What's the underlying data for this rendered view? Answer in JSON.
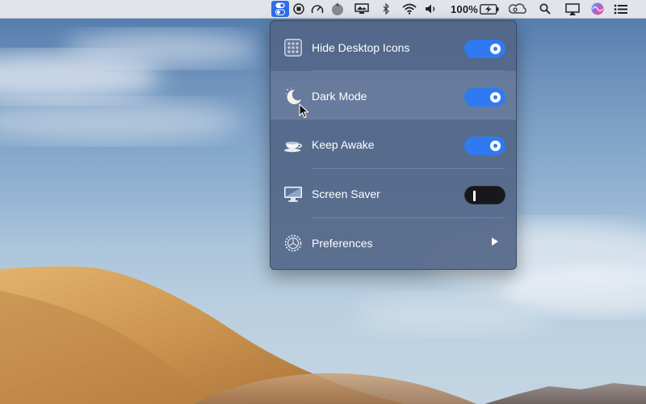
{
  "menubar": {
    "battery_text": "100%",
    "icons": [
      "one-switch-icon",
      "record-icon",
      "gauge-icon",
      "tomato-icon",
      "display-icon",
      "bluetooth-icon",
      "wifi-icon",
      "volume-icon",
      "battery-icon",
      "creative-cloud-icon",
      "search-icon",
      "airplay-icon",
      "siri-icon",
      "list-icon"
    ],
    "active_color": "#2f6fe6"
  },
  "panel": {
    "items": [
      {
        "label": "Hide Desktop Icons",
        "icon": "grid-icon",
        "control": "toggle",
        "on": true
      },
      {
        "label": "Dark Mode",
        "icon": "moon-icon",
        "control": "toggle",
        "on": true
      },
      {
        "label": "Keep Awake",
        "icon": "coffee-cup-icon",
        "control": "toggle",
        "on": true
      },
      {
        "label": "Screen Saver",
        "icon": "monitor-icon",
        "control": "toggle",
        "on": false
      },
      {
        "label": "Preferences",
        "icon": "settings-icon",
        "control": "submenu"
      }
    ],
    "accent": "#2f7af0",
    "off_color": "#17181c"
  }
}
